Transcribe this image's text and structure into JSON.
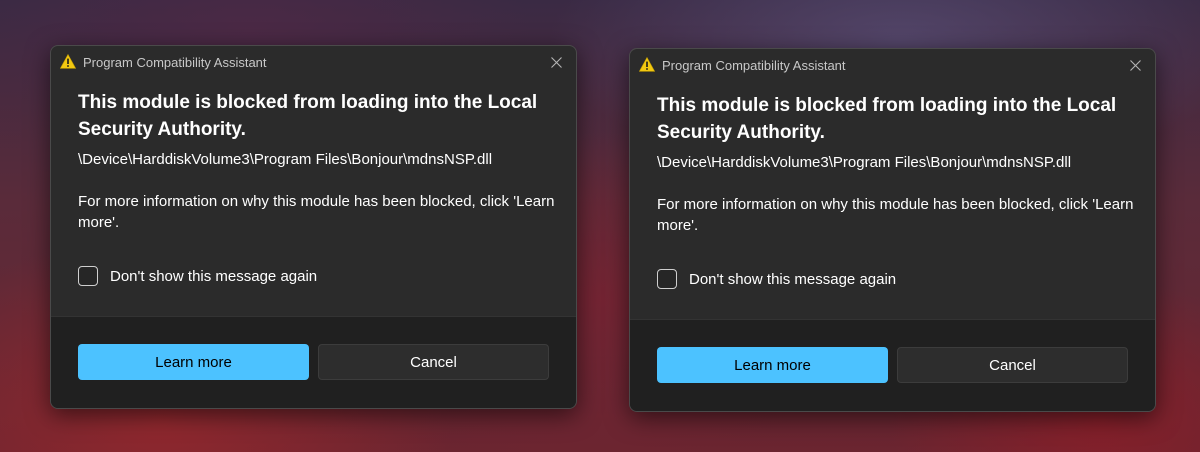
{
  "colors": {
    "dialog_bg": "#2b2b2b",
    "footer_bg": "#202020",
    "accent": "#4cc2ff",
    "warning": "#f2c811"
  },
  "dialogs": [
    {
      "title": "Program Compatibility Assistant",
      "title_icon": "warning-icon",
      "close_icon": "close-icon",
      "heading": "This module is blocked from loading into the Local Security Authority.",
      "path": "\\Device\\HarddiskVolume3\\Program Files\\Bonjour\\mdnsNSP.dll",
      "info": "For more information on why this module has been blocked, click 'Learn more'.",
      "checkbox_label": "Don't show this message again",
      "checkbox_checked": false,
      "primary_button": "Learn more",
      "secondary_button": "Cancel"
    },
    {
      "title": "Program Compatibility Assistant",
      "title_icon": "warning-icon",
      "close_icon": "close-icon",
      "heading": "This module is blocked from loading into the Local Security Authority.",
      "path": "\\Device\\HarddiskVolume3\\Program Files\\Bonjour\\mdnsNSP.dll",
      "info": "For more information on why this module has been blocked, click 'Learn more'.",
      "checkbox_label": "Don't show this message again",
      "checkbox_checked": false,
      "primary_button": "Learn more",
      "secondary_button": "Cancel"
    }
  ]
}
